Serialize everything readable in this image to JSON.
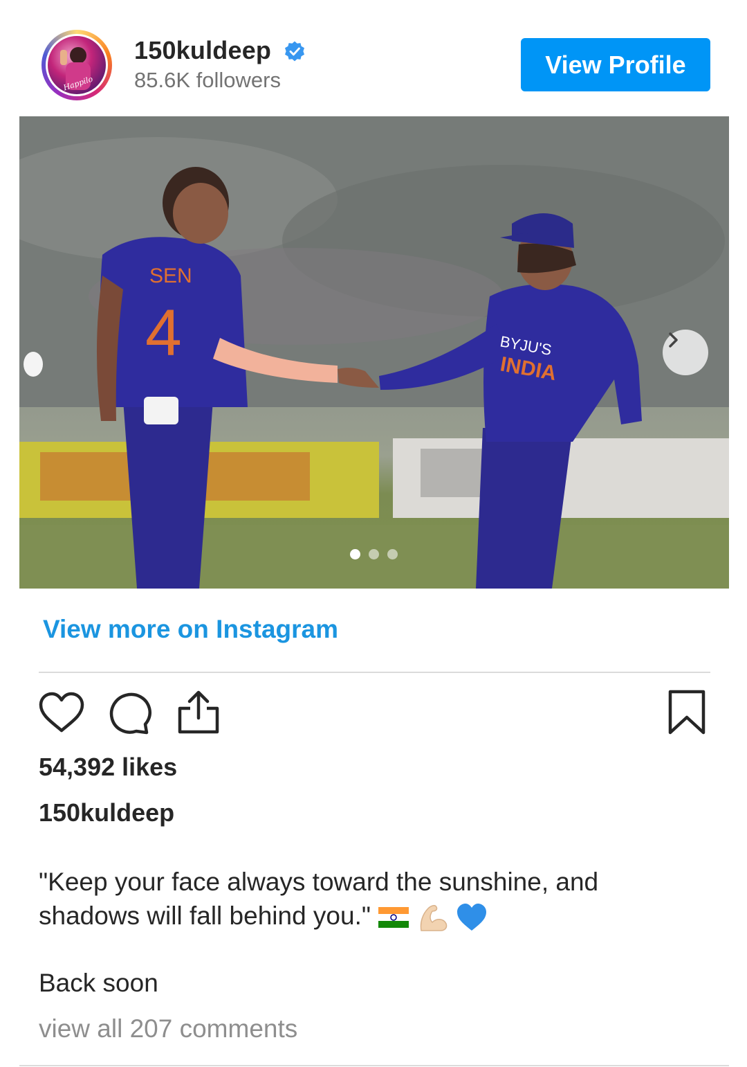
{
  "profile": {
    "username": "150kuldeep",
    "verified": true,
    "followers": "85.6K followers",
    "avatar_text": "Happilo",
    "view_profile_label": "View Profile"
  },
  "post": {
    "carousel": {
      "total_slides": 3,
      "active_slide": 1
    },
    "jersey_text": "SEN",
    "jersey_number": "4",
    "jersey2_text": "BYJU'S",
    "jersey2_sub": "INDIA",
    "view_more_label": "View more on Instagram",
    "likes": "54,392 likes",
    "caption_user": "150kuldeep",
    "caption_text": "\"Keep your face always toward the sunshine, and shadows will fall behind you.\"",
    "caption_emojis": [
      "flag-india-icon",
      "flexed-biceps-icon",
      "blue-heart-icon"
    ],
    "caption_line2": "Back soon",
    "comments_link": "view all 207 comments"
  },
  "colors": {
    "accent": "#0095f6",
    "link": "#1b95e0",
    "verified_badge": "#3897f0",
    "muted": "#8e8e8e"
  },
  "icons": [
    "heart-icon",
    "comment-icon",
    "share-icon",
    "bookmark-icon",
    "chevron-right-icon",
    "verified-badge-icon"
  ]
}
